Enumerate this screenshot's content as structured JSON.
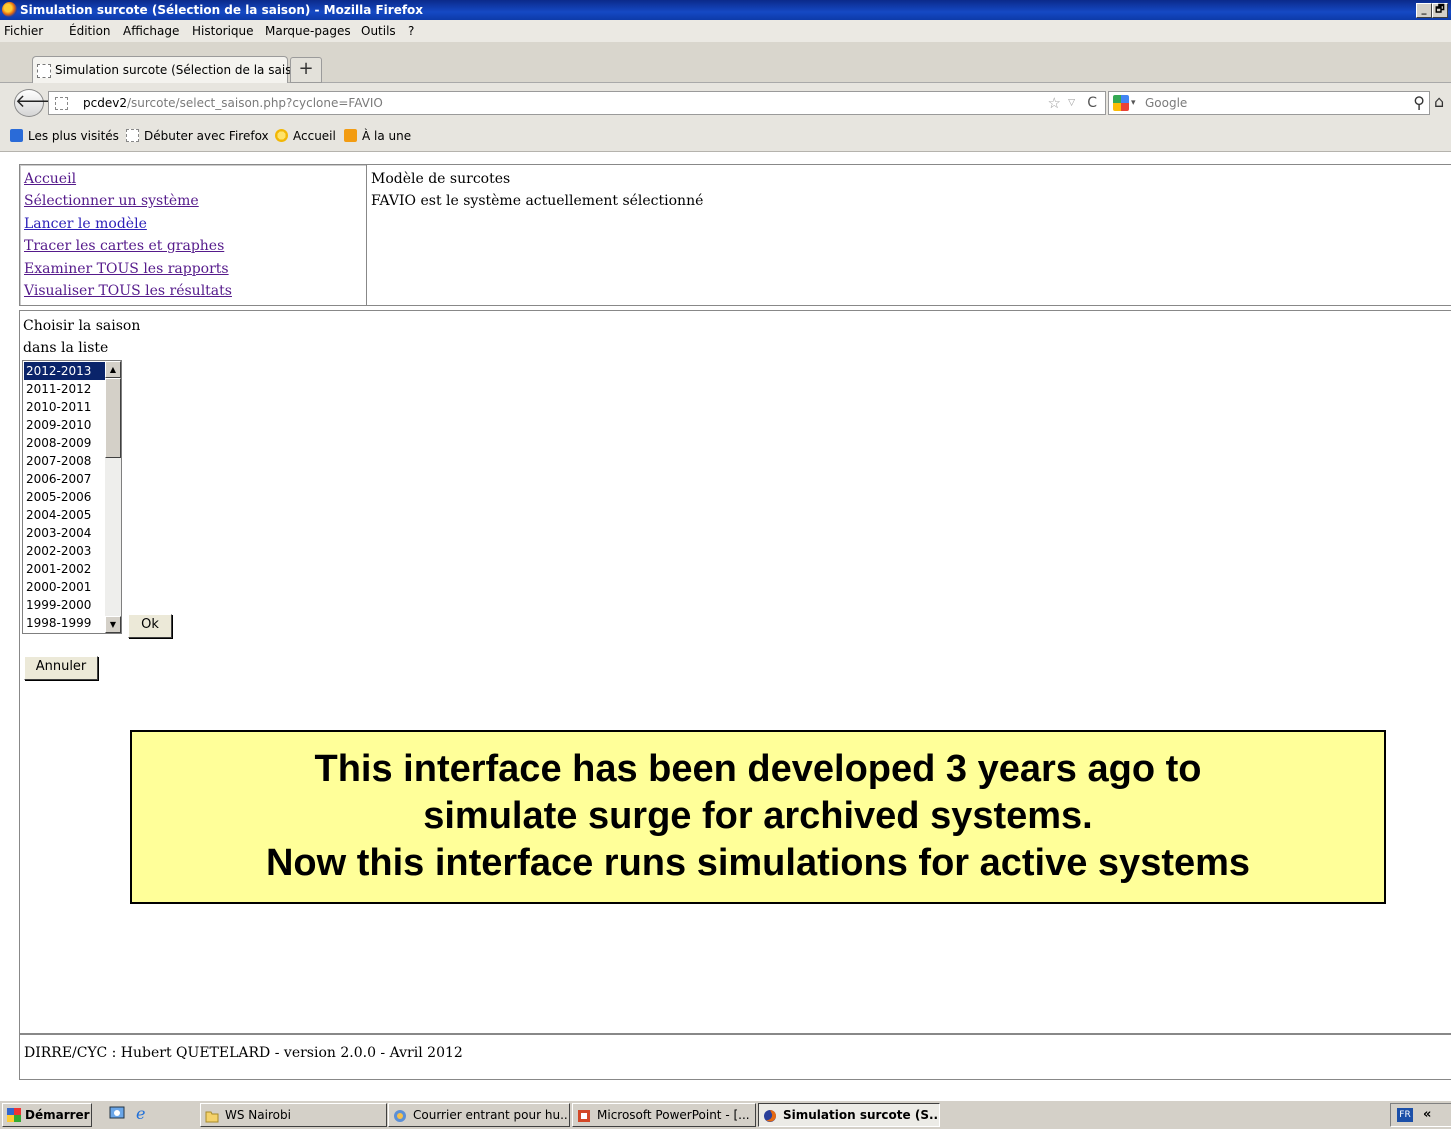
{
  "window": {
    "title": "Simulation surcote (Sélection de la saison) - Mozilla Firefox",
    "minimize": "_",
    "maximize": "🗗"
  },
  "menubar": [
    "Fichier",
    "Édition",
    "Affichage",
    "Historique",
    "Marque-pages",
    "Outils",
    "?"
  ],
  "tab": {
    "label": "Simulation surcote (Sélection de la saison)",
    "new_tab": "+"
  },
  "navbar": {
    "url_host": "pcdev2",
    "url_path": "/surcote/select_saison.php?cyclone=FAVIO",
    "search_placeholder": "Google"
  },
  "bookmarks": [
    "Les plus visités",
    "Débuter avec Firefox",
    "Accueil",
    "À la une"
  ],
  "page": {
    "nav_links": [
      "Accueil",
      "Sélectionner un système",
      "Lancer le modèle",
      "Tracer les cartes et graphes",
      "Examiner TOUS les rapports",
      "Visualiser TOUS les résultats"
    ],
    "header_title": "Modèle de surcotes",
    "header_status": "FAVIO est le système actuellement sélectionné",
    "choose_label_1": "Choisir la saison",
    "choose_label_2": "dans la liste",
    "seasons": [
      "2012-2013",
      "2011-2012",
      "2010-2011",
      "2009-2010",
      "2008-2009",
      "2007-2008",
      "2006-2007",
      "2005-2006",
      "2004-2005",
      "2003-2004",
      "2002-2003",
      "2001-2002",
      "2000-2001",
      "1999-2000",
      "1998-1999"
    ],
    "selected_season": "2012-2013",
    "ok_label": "Ok",
    "cancel_label": "Annuler",
    "footer": "DIRRE/CYC : Hubert QUETELARD - version 2.0.0 - Avril 2012"
  },
  "annotation": {
    "line1": "This interface has been developed 3 years ago to",
    "line2": "simulate surge for archived systems.",
    "line3": "Now this interface runs simulations for active systems",
    "background_color": "#ffff99"
  },
  "taskbar": {
    "start_label": "Démarrer",
    "tasks": [
      "WS Nairobi",
      "Courrier entrant pour hu...",
      "Microsoft PowerPoint - [...",
      "Simulation surcote (S..."
    ],
    "language": "FR",
    "tray_arrow": "«"
  }
}
